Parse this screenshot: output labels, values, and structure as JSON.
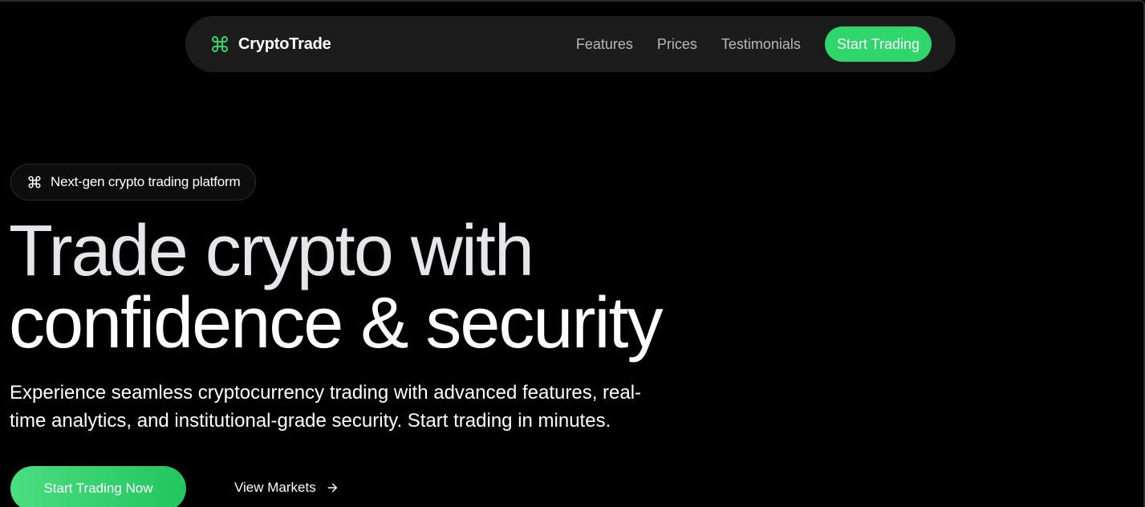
{
  "navbar": {
    "brand": {
      "icon": "command-icon",
      "name": "CryptoTrade"
    },
    "links": [
      {
        "label": "Features"
      },
      {
        "label": "Prices"
      },
      {
        "label": "Testimonials"
      }
    ],
    "cta_label": "Start Trading"
  },
  "hero": {
    "badge": {
      "icon": "command-icon",
      "text": "Next-gen crypto trading platform"
    },
    "headline_line1": "Trade crypto with",
    "headline_line2": "confidence & security",
    "subtext": "Experience seamless cryptocurrency trading with advanced features, real-time analytics, and institutional-grade security. Start trading in minutes.",
    "primary_button": "Start Trading Now",
    "secondary_button": "View Markets",
    "secondary_icon": "arrow-right-icon"
  },
  "colors": {
    "background": "#000000",
    "navbar": "#1c1c1c",
    "accent": "#2fd66c",
    "nav_link": "#b8b8b8"
  }
}
